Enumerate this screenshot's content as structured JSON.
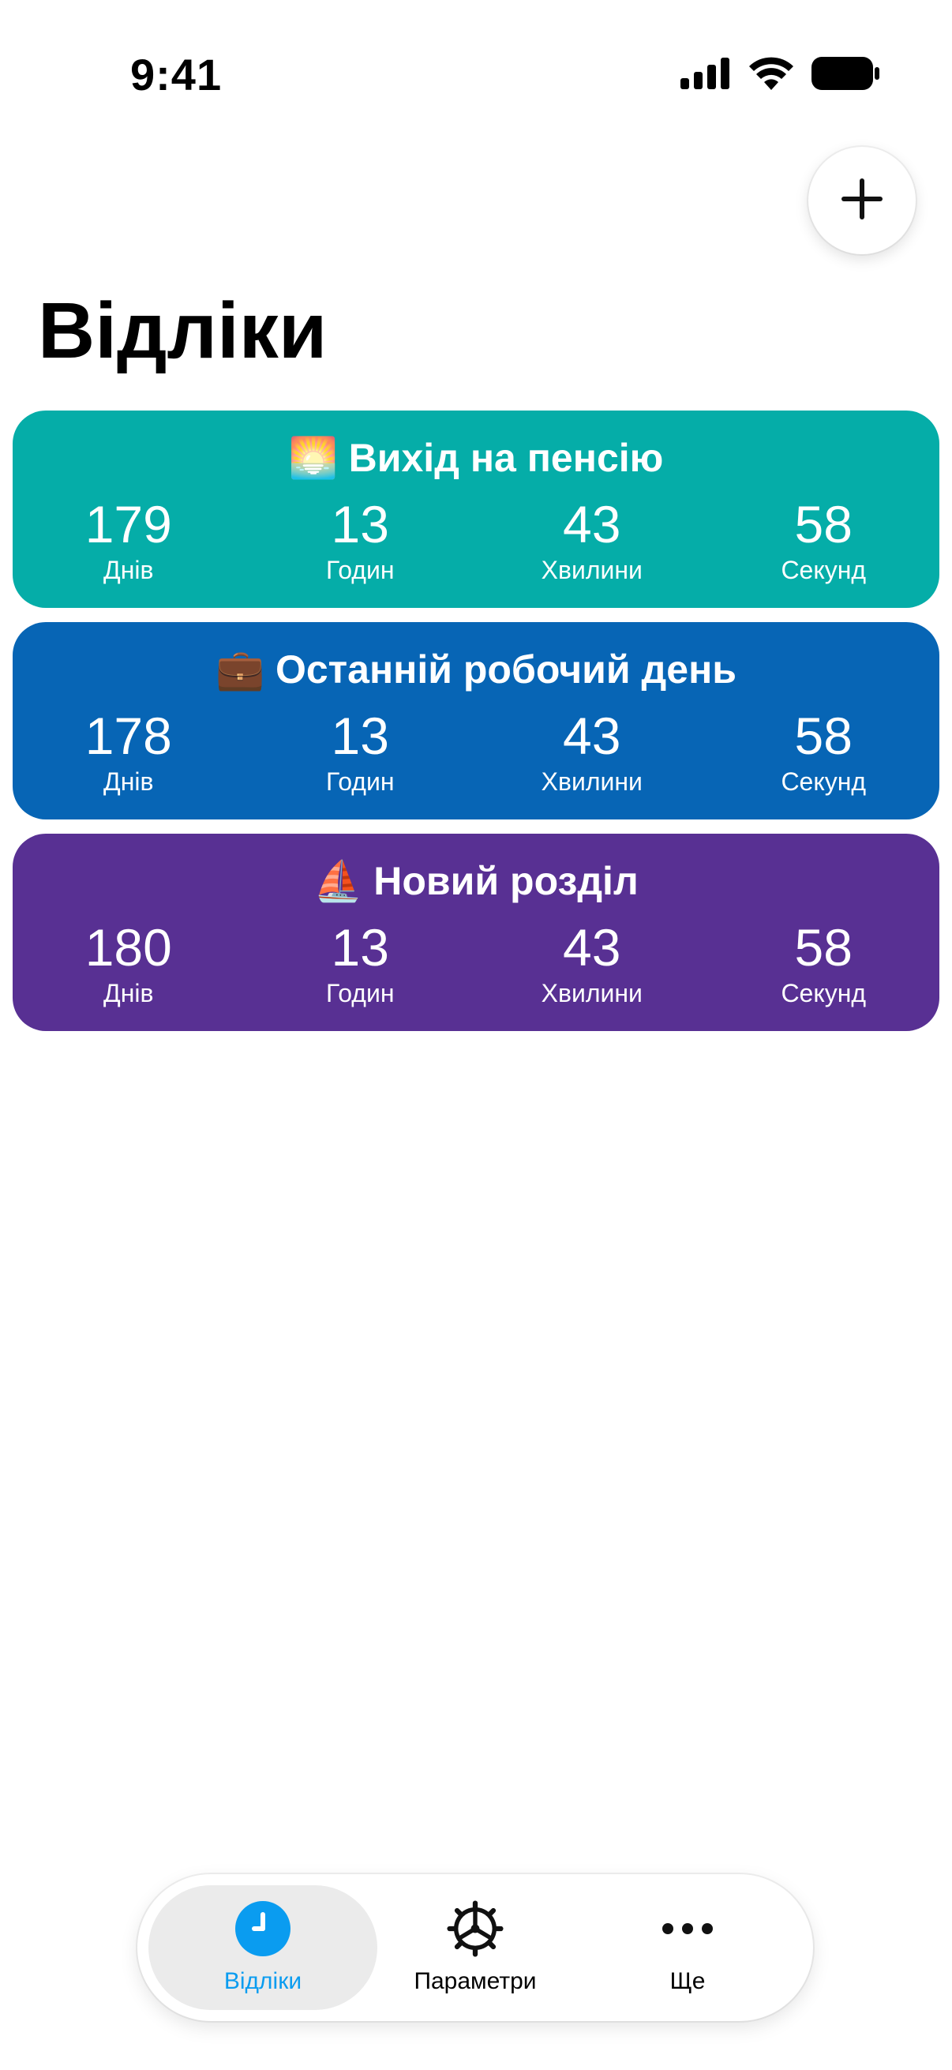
{
  "status_bar": {
    "time": "9:41",
    "icons": [
      "cellular-signal-icon",
      "wifi-icon",
      "battery-icon"
    ]
  },
  "header": {
    "add_icon": "plus-icon",
    "title": "Відліки"
  },
  "countdowns": [
    {
      "emoji": "🌅",
      "title": "Вихід на пенсію",
      "color": "#05ada8",
      "values": {
        "days": "179",
        "hours": "13",
        "minutes": "43",
        "seconds": "58"
      },
      "labels": {
        "days": "Днів",
        "hours": "Годин",
        "minutes": "Хвилини",
        "seconds": "Секунд"
      }
    },
    {
      "emoji": "💼",
      "title": "Останній робочий день",
      "color": "#0765b5",
      "values": {
        "days": "178",
        "hours": "13",
        "minutes": "43",
        "seconds": "58"
      },
      "labels": {
        "days": "Днів",
        "hours": "Годин",
        "minutes": "Хвилини",
        "seconds": "Секунд"
      }
    },
    {
      "emoji": "⛵",
      "title": "Новий розділ",
      "color": "#583093",
      "values": {
        "days": "180",
        "hours": "13",
        "minutes": "43",
        "seconds": "58"
      },
      "labels": {
        "days": "Днів",
        "hours": "Годин",
        "minutes": "Хвилини",
        "seconds": "Секунд"
      }
    }
  ],
  "tab_bar": {
    "tabs": [
      {
        "label": "Відліки",
        "icon": "clock-icon",
        "active": true
      },
      {
        "label": "Параметри",
        "icon": "gear-icon",
        "active": false
      },
      {
        "label": "Ще",
        "icon": "ellipsis-icon",
        "active": false
      }
    ],
    "accent": "#0a9cf0"
  }
}
